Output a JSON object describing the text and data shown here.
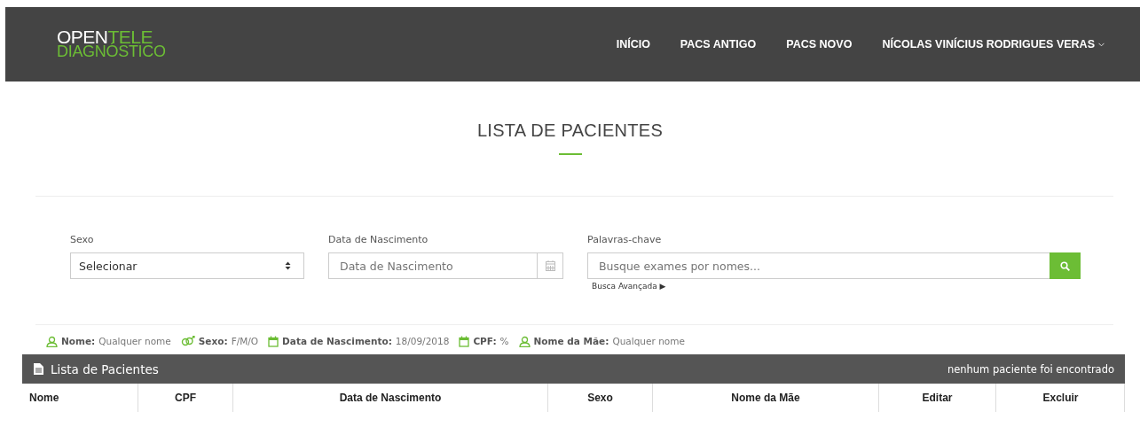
{
  "header": {
    "logo": {
      "line1_white": "OPEN",
      "line1_green": "TELE",
      "line2": "DIAGNÓSTICO"
    },
    "nav": [
      {
        "label": "INÍCIO",
        "dropdown": false
      },
      {
        "label": "PACS ANTIGO",
        "dropdown": false
      },
      {
        "label": "PACS NOVO",
        "dropdown": false
      },
      {
        "label": "NÍCOLAS VINÍCIUS RODRIGUES VERAS",
        "dropdown": true
      }
    ]
  },
  "page_title": "LISTA DE PACIENTES",
  "filters": {
    "sexo": {
      "label": "Sexo",
      "value": "Selecionar"
    },
    "birth_date": {
      "label": "Data de Nascimento",
      "placeholder": "Data de Nascimento"
    },
    "keywords": {
      "label": "Palavras-chave",
      "placeholder": "Busque exames por nomes...",
      "advanced_link": "Busca Avançada ▶"
    }
  },
  "summary": [
    {
      "kind": "person",
      "label": "Nome:",
      "value": "Qualquer nome"
    },
    {
      "kind": "gender",
      "label": "Sexo:",
      "value": "F/M/O"
    },
    {
      "kind": "calendar",
      "label": "Data de Nascimento:",
      "value": "18/09/2018"
    },
    {
      "kind": "calendar",
      "label": "CPF:",
      "value": "%"
    },
    {
      "kind": "person",
      "label": "Nome da Mãe:",
      "value": "Qualquer nome"
    }
  ],
  "table": {
    "title": "Lista de Pacientes",
    "status": "nenhum paciente foi encontrado",
    "columns": [
      "Nome",
      "CPF",
      "Data de Nascimento",
      "Sexo",
      "Nome da Mãe",
      "Editar",
      "Excluir"
    ]
  }
}
